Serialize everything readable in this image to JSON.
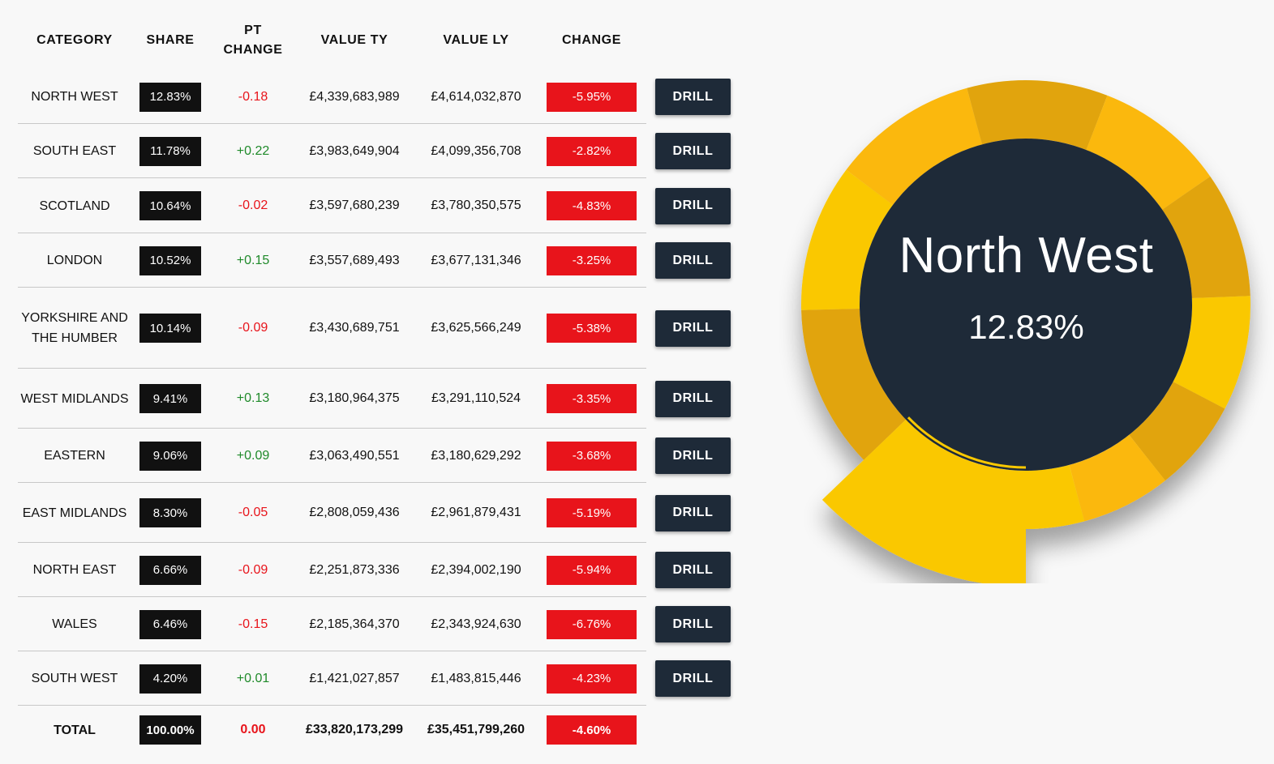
{
  "table": {
    "headers": {
      "category": "CATEGORY",
      "share": "SHARE",
      "pt_change_1": "PT",
      "pt_change_2": "CHANGE",
      "value_ty": "VALUE TY",
      "value_ly": "VALUE LY",
      "change": "CHANGE"
    },
    "drill_label": "DRILL",
    "rows": [
      {
        "category": "NORTH WEST",
        "share": "12.83%",
        "pt_change": "-0.18",
        "value_ty": "£4,339,683,989",
        "value_ly": "£4,614,032,870",
        "change": "-5.95%"
      },
      {
        "category": "SOUTH EAST",
        "share": "11.78%",
        "pt_change": "+0.22",
        "value_ty": "£3,983,649,904",
        "value_ly": "£4,099,356,708",
        "change": "-2.82%"
      },
      {
        "category": "SCOTLAND",
        "share": "10.64%",
        "pt_change": "-0.02",
        "value_ty": "£3,597,680,239",
        "value_ly": "£3,780,350,575",
        "change": "-4.83%"
      },
      {
        "category": "LONDON",
        "share": "10.52%",
        "pt_change": "+0.15",
        "value_ty": "£3,557,689,493",
        "value_ly": "£3,677,131,346",
        "change": "-3.25%"
      },
      {
        "category": "YORKSHIRE AND THE HUMBER",
        "share": "10.14%",
        "pt_change": "-0.09",
        "value_ty": "£3,430,689,751",
        "value_ly": "£3,625,566,249",
        "change": "-5.38%"
      },
      {
        "category": "WEST MIDLANDS",
        "share": "9.41%",
        "pt_change": "+0.13",
        "value_ty": "£3,180,964,375",
        "value_ly": "£3,291,110,524",
        "change": "-3.35%"
      },
      {
        "category": "EASTERN",
        "share": "9.06%",
        "pt_change": "+0.09",
        "value_ty": "£3,063,490,551",
        "value_ly": "£3,180,629,292",
        "change": "-3.68%"
      },
      {
        "category": "EAST MIDLANDS",
        "share": "8.30%",
        "pt_change": "-0.05",
        "value_ty": "£2,808,059,436",
        "value_ly": "£2,961,879,431",
        "change": "-5.19%"
      },
      {
        "category": "NORTH EAST",
        "share": "6.66%",
        "pt_change": "-0.09",
        "value_ty": "£2,251,873,336",
        "value_ly": "£2,394,002,190",
        "change": "-5.94%"
      },
      {
        "category": "WALES",
        "share": "6.46%",
        "pt_change": "-0.15",
        "value_ty": "£2,185,364,370",
        "value_ly": "£2,343,924,630",
        "change": "-6.76%"
      },
      {
        "category": "SOUTH WEST",
        "share": "4.20%",
        "pt_change": "+0.01",
        "value_ty": "£1,421,027,857",
        "value_ly": "£1,483,815,446",
        "change": "-4.23%"
      }
    ],
    "total": {
      "category": "TOTAL",
      "share": "100.00%",
      "pt_change": "0.00",
      "value_ty": "£33,820,173,299",
      "value_ly": "£35,451,799,260",
      "change": "-4.60%"
    }
  },
  "colors": {
    "negative": "#e8141b",
    "positive": "#1f8a2a",
    "drill_bg": "#1e2a38",
    "donut_center": "#1e2a38",
    "segment_a": "#fac800",
    "segment_b": "#e1a408",
    "segment_c": "#fbb80b"
  },
  "chart_data": {
    "type": "pie",
    "style": "donut",
    "highlighted": "North West",
    "center_title": "North West",
    "center_value": "12.83%",
    "categories": [
      "NORTH WEST",
      "SOUTH EAST",
      "SCOTLAND",
      "LONDON",
      "YORKSHIRE AND THE HUMBER",
      "WEST MIDLANDS",
      "EASTERN",
      "EAST MIDLANDS",
      "NORTH EAST",
      "WALES",
      "SOUTH WEST"
    ],
    "values": [
      12.83,
      11.78,
      10.64,
      10.52,
      10.14,
      9.41,
      9.06,
      8.3,
      6.66,
      6.46,
      4.2
    ]
  }
}
